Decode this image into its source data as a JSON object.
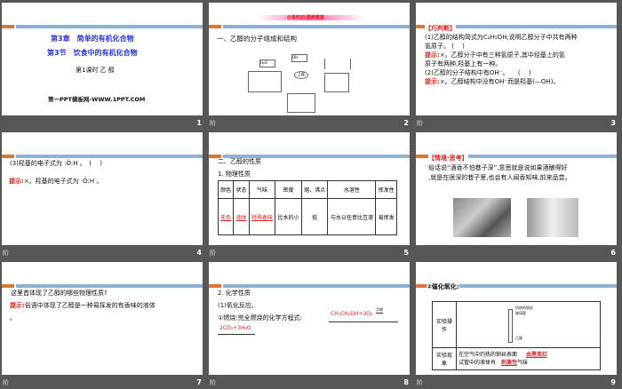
{
  "slides": [
    {
      "number": "1",
      "chapter": "第3章　简单的有机化合物",
      "section": "第3节　饮食中的有机化合物",
      "lesson": "第1课时 乙 醇",
      "footer": "第一PPT模板网-WWW.1PPT.COM"
    },
    {
      "number": "2",
      "banner": "必备知识·素养奠基",
      "title": "一、乙醇的分子组成和结构",
      "diagram_center": "乙醇",
      "diagram_labels": [
        "H₂O",
        "OH"
      ]
    },
    {
      "number": "3",
      "tag": "【巧判断】",
      "q1": "(1)乙醇的结构简式为C₂H₅OH,说明乙醇分子中共有两种",
      "q1b": "氢原子。  (　 )",
      "hint_label": "提示:",
      "a1": "×。乙醇分子中有三种氢原子,其中烃基上的氢",
      "a1b": "原子有两种,羟基上有一种。",
      "q2": "(2)乙醇的分子结构中有OH⁻。　　(　 )",
      "a2": "×。乙醇结构中没有OH⁻而是羟基(—OH)。"
    },
    {
      "number": "4",
      "q3": "(3)羟基的电子式为 :Ö:H 。　(　 )",
      "hint_label": "提示:",
      "a3": "×。羟基的电子式为 ·Ö:H 。"
    },
    {
      "number": "5",
      "title": "二、乙醇的性质",
      "subtitle": "1. 物理性质",
      "headers": [
        "颜色",
        "状态",
        "气味",
        "密度",
        "熔、沸点",
        "水溶性",
        "挥发性"
      ],
      "values": [
        "无色",
        "液体",
        "特殊香味",
        "比水的小",
        "低",
        "与水以任意比互溶",
        "易挥发"
      ]
    },
    {
      "number": "6",
      "tag": "【情境·思考】",
      "text1": "俗话说“酒香不怕巷子深”,意思就是说如果酒酿得好",
      "text2": ",就是在很深的巷子里,也会有人闻香知味,前来品尝。"
    },
    {
      "number": "7",
      "q": "这里首体现了乙醇的哪些物理性质?",
      "hint_label": "提示:",
      "a": "俗语中体现了乙醇是一种易挥发的有香味的液体",
      "a_end": "。"
    },
    {
      "number": "8",
      "title": "2. 化学性质",
      "sub": "(1)氧化反应。",
      "item": "①燃烧:完全燃烧的化学方程式:",
      "eq1": "CH₃CH₂OH+3O₂",
      "cond": "点燃",
      "eq2": "2CO₂+3H₂O"
    },
    {
      "number": "9",
      "title": "②催化氧化:",
      "row1": "实验操作",
      "row2": "实验现象",
      "labels": [
        "灼热的铜丝",
        "玻璃管",
        "乙醇"
      ],
      "obs1": "在空气中灼热的铜丝表面",
      "ans1": "由黑变红",
      "obs2": "试管中的液体有",
      "ans2": "刺激性",
      "obs2_end": "气味"
    }
  ],
  "nav_label": "阶"
}
